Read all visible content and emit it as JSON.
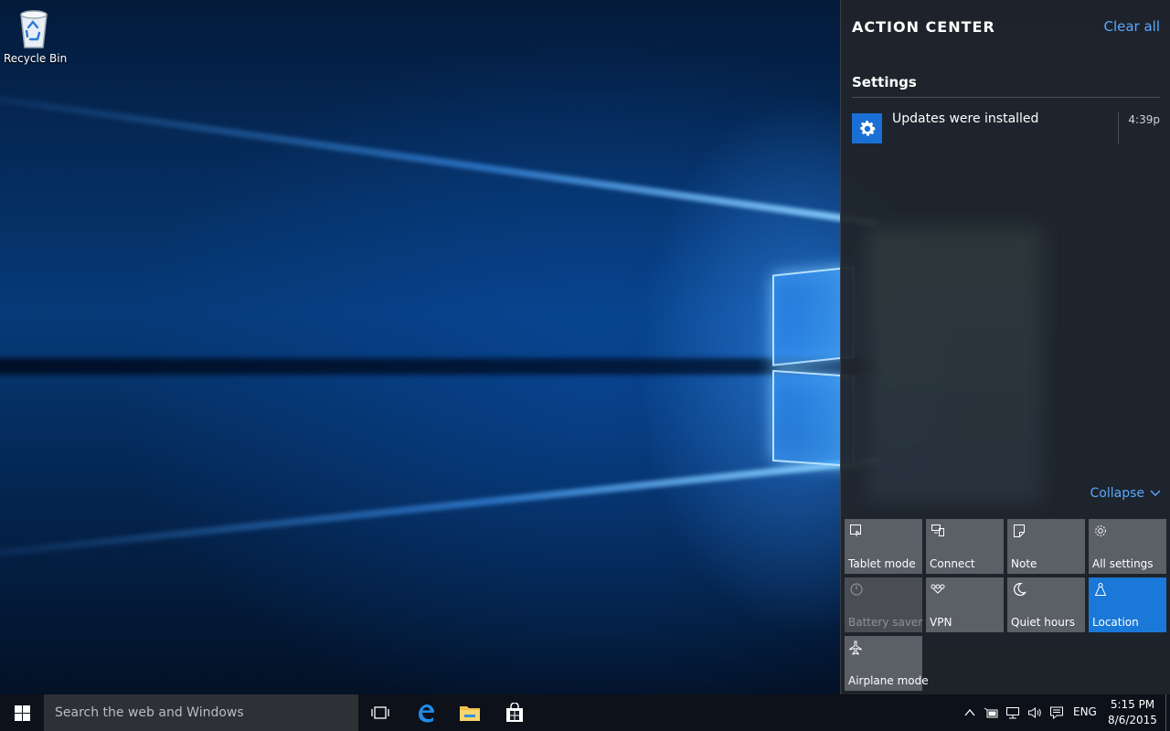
{
  "desktop": {
    "icons": [
      {
        "label": "Recycle Bin",
        "icon": "recycle-bin-icon"
      }
    ]
  },
  "action_center": {
    "title": "ACTION CENTER",
    "clear_all": "Clear all",
    "group": {
      "title": "Settings",
      "notifications": [
        {
          "text": "Updates were installed",
          "time": "4:39p",
          "icon": "gear-icon"
        }
      ]
    },
    "collapse_label": "Collapse",
    "quick_actions": [
      {
        "label": "Tablet mode",
        "icon": "tablet-mode-icon",
        "state": "off"
      },
      {
        "label": "Connect",
        "icon": "connect-icon",
        "state": "off"
      },
      {
        "label": "Note",
        "icon": "note-icon",
        "state": "off"
      },
      {
        "label": "All settings",
        "icon": "gear-icon",
        "state": "off"
      },
      {
        "label": "Battery saver",
        "icon": "battery-saver-icon",
        "state": "disabled"
      },
      {
        "label": "VPN",
        "icon": "vpn-icon",
        "state": "off"
      },
      {
        "label": "Quiet hours",
        "icon": "moon-icon",
        "state": "off"
      },
      {
        "label": "Location",
        "icon": "location-icon",
        "state": "on"
      },
      {
        "label": "Airplane mode",
        "icon": "airplane-icon",
        "state": "off"
      }
    ],
    "accent_color": "#1a78d8"
  },
  "taskbar": {
    "search_placeholder": "Search the web and Windows",
    "pinned": [
      {
        "name": "task-view",
        "icon": "task-view-icon"
      },
      {
        "name": "edge",
        "icon": "edge-icon"
      },
      {
        "name": "file-explorer",
        "icon": "folder-icon"
      },
      {
        "name": "store",
        "icon": "store-icon"
      }
    ],
    "language": "ENG",
    "time": "5:15 PM",
    "date": "8/6/2015"
  }
}
